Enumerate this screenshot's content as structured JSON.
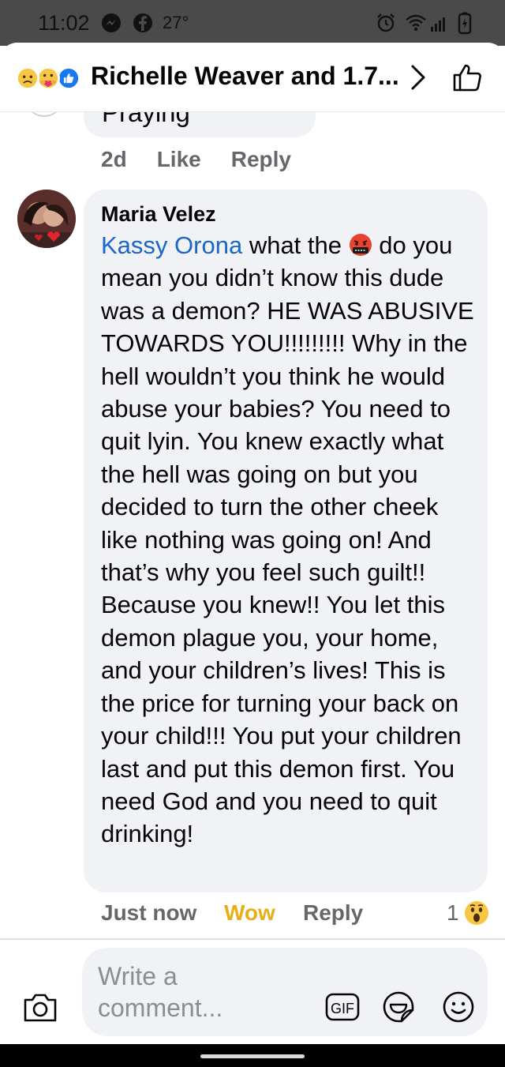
{
  "status_bar": {
    "time": "11:02",
    "temperature": "27°",
    "icons": [
      "messenger-icon",
      "facebook-icon",
      "alarm-icon",
      "wifi-icon",
      "signal-icon",
      "battery-icon"
    ]
  },
  "header": {
    "title": "Richelle Weaver and 1.7...",
    "reaction_icons": [
      "sad-reaction-icon",
      "care-reaction-icon",
      "like-reaction-icon"
    ],
    "next_icon": "chevron-right-icon",
    "like_icon": "thumbs-up-icon"
  },
  "previous_comment": {
    "text_fragment": "Praying",
    "time": "2d",
    "like_label": "Like",
    "reply_label": "Reply"
  },
  "comment": {
    "author": "Maria Velez",
    "mention": "Kassy Orona",
    "text_before_emoji": " what the ",
    "emoji": "face-with-symbols-on-mouth-icon",
    "text_after_emoji": " do you mean you didn’t know this dude was a demon? HE WAS ABUSIVE TOWARDS YOU!!!!!!!!! Why in the hell wouldn’t you think he would abuse your babies? You need to quit lyin. You knew exactly what the hell was going on but you decided to turn the other cheek like nothing was going on! And that’s why you feel such guilt!! Because you knew!! You let this demon plague you, your home, and your children’s lives! This is the price for turning your back on your child!!! You put your children last and put this demon first. You need God and you need to quit drinking!",
    "time": "Just now",
    "reaction_label": "Wow",
    "reply_label": "Reply",
    "reaction_count": "1",
    "reaction_icon": "wow-reaction-icon"
  },
  "composer": {
    "placeholder": "Write a comment...",
    "camera_icon": "camera-icon",
    "gif_icon": "gif-icon",
    "sticker_icon": "sticker-icon",
    "emoji_icon": "smiley-icon"
  },
  "colors": {
    "mention": "#1b66c9",
    "wow": "#e6ae17",
    "bubble": "#f0f2f5",
    "meta": "#65676b"
  }
}
